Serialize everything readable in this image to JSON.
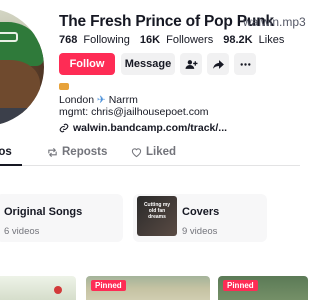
{
  "profile": {
    "display_name": "The Fresh Prince of Pop Punk",
    "handle": "walwin.mp3",
    "stats": {
      "following_count": "768",
      "following_label": "Following",
      "followers_count": "16K",
      "followers_label": "Followers",
      "likes_count": "98.2K",
      "likes_label": "Likes"
    },
    "actions": {
      "follow_label": "Follow",
      "message_label": "Message"
    },
    "bio": {
      "location_line": "London ✈️ Narrm",
      "location_from": "London",
      "location_to": "Narrm",
      "mgmt_line": "mgmt: chris@jailhousepoet.com",
      "link": "walwin.bandcamp.com/track/..."
    }
  },
  "tabs": [
    {
      "label": "eos",
      "active": true
    },
    {
      "label": "Reposts",
      "active": false
    },
    {
      "label": "Liked",
      "active": false
    }
  ],
  "collections": [
    {
      "name": "Original Songs",
      "count": "6 videos"
    },
    {
      "name": "Covers",
      "count": "9 videos",
      "thumb_text": "Cutting my old fan dreams"
    }
  ],
  "videos": [
    {
      "pinned": false
    },
    {
      "pinned": true,
      "badge": "Pinned"
    },
    {
      "pinned": true,
      "badge": "Pinned"
    }
  ],
  "colors": {
    "accent": "#fe2c55",
    "text": "#161823",
    "muted": "#73747b",
    "button_bg": "#f1f1f2"
  }
}
